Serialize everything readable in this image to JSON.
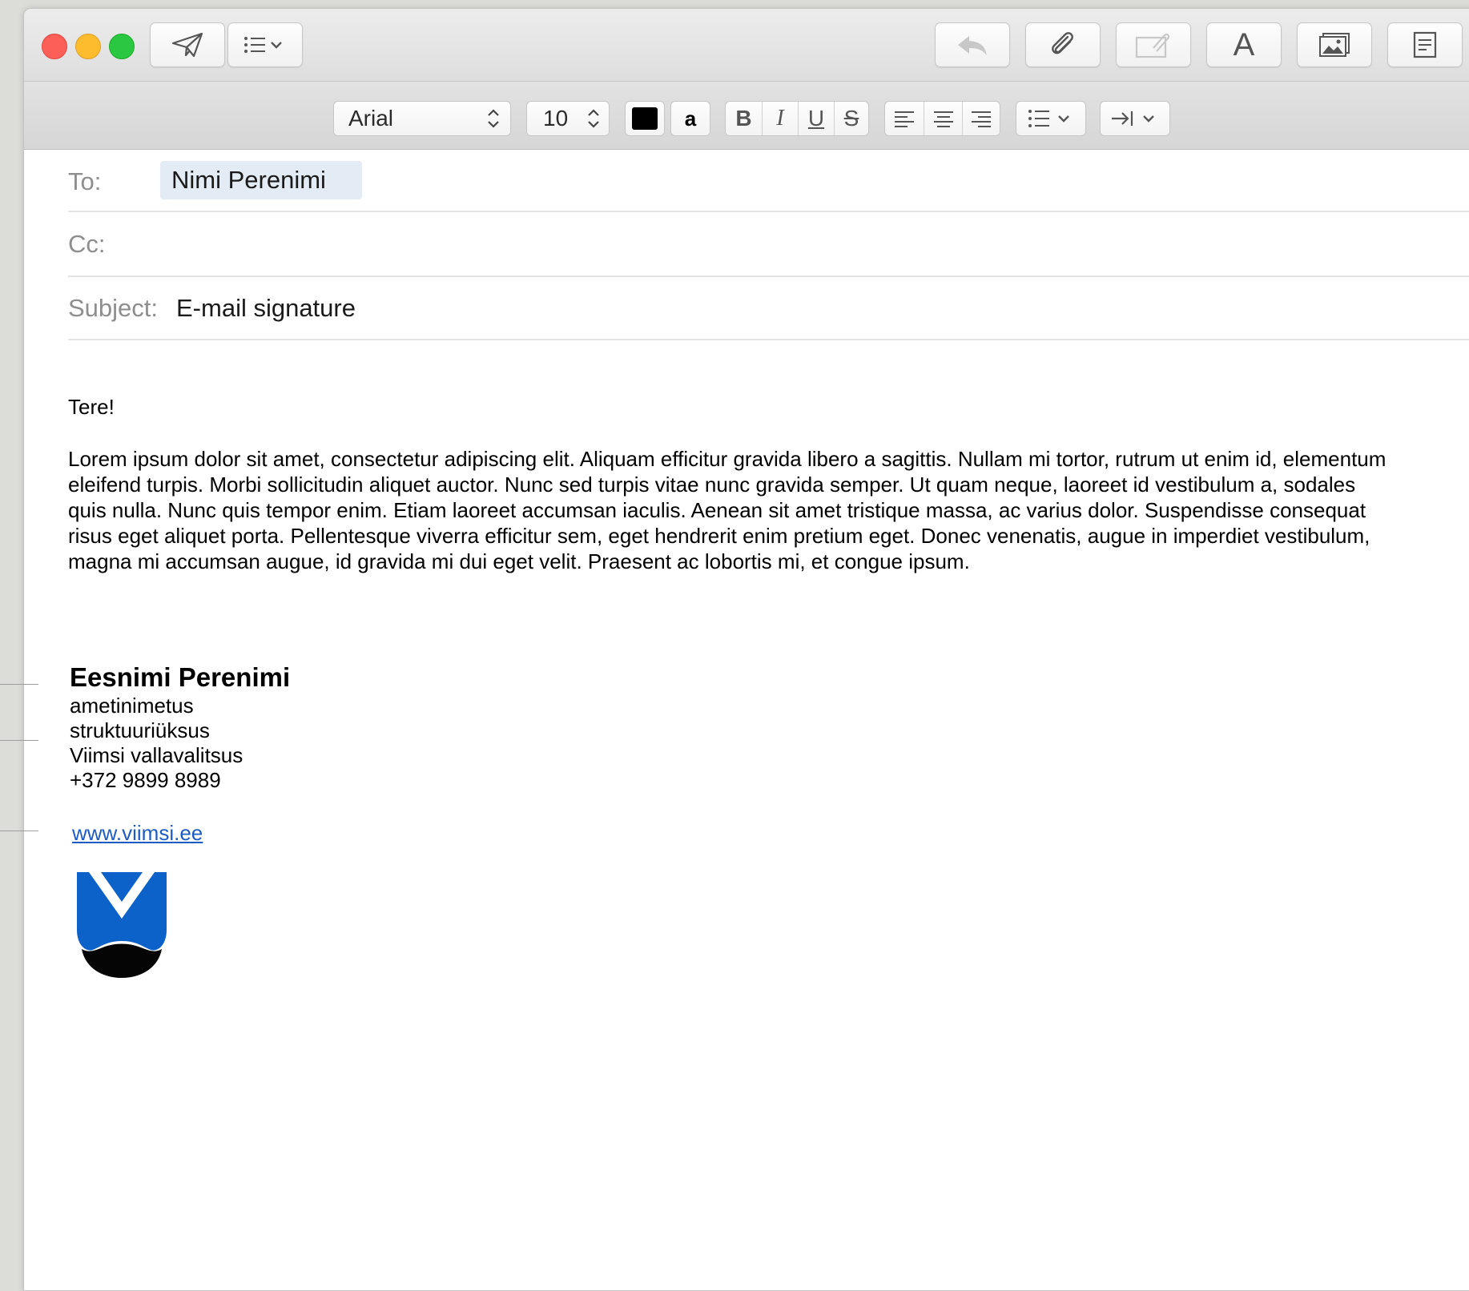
{
  "toolbar": {
    "send_icon": "paper-plane-icon",
    "header_fields_icon": "list-chevron-icon",
    "reply_icon": "reply-arrow-icon",
    "attach_icon": "paperclip-icon",
    "markup_icon": "markup-icon",
    "format_icon": "letter-a-icon",
    "format_label": "A",
    "photo_icon": "photo-browser-icon",
    "template_icon": "stationery-icon"
  },
  "format": {
    "font_name": "Arial",
    "font_size": "10",
    "text_color": "#000000",
    "highlight_label": "a",
    "bold_label": "B",
    "italic_label": "I",
    "underline_label": "U",
    "strike_label": "S"
  },
  "header": {
    "to_label": "To:",
    "to_recipient": "Nimi Perenimi",
    "cc_label": "Cc:",
    "subject_label": "Subject:",
    "subject_value": "E-mail signature"
  },
  "message": {
    "greeting": "Tere!",
    "paragraph_lines": [
      "Lorem ipsum dolor sit amet, consectetur adipiscing elit. Aliquam efficitur gravida libero a sagittis. Nullam mi tortor, rutrum ut enim id, elementum",
      "eleifend turpis. Morbi sollicitudin aliquet auctor. Nunc sed turpis vitae nunc gravida semper. Ut quam neque, laoreet id vestibulum a, sodales",
      "quis nulla. Nunc quis tempor enim. Etiam laoreet accumsan iaculis. Aenean sit amet tristique massa, ac varius dolor. Suspendisse consequat",
      "risus eget aliquet porta. Pellentesque viverra efficitur sem, eget hendrerit enim pretium eget. Donec venenatis, augue in imperdiet vestibulum,",
      "magna mi accumsan augue, id gravida mi dui eget velit. Praesent ac lobortis mi, et congue ipsum."
    ]
  },
  "signature": {
    "name": "Eesnimi Perenimi",
    "title": "ametinimetus",
    "unit": "struktuuriüksus",
    "organization": "Viimsi vallavalitsus",
    "phone": "+372 9899 8989",
    "website": "www.viimsi.ee",
    "logo_icon": "viimsi-coat-of-arms-icon"
  },
  "colors": {
    "close": "#fc5f57",
    "minimize": "#fdbc2e",
    "zoom": "#29c840",
    "link": "#1d5cc4",
    "logo_blue": "#0c62c9",
    "recipient_chip": "#e3ebf5"
  }
}
